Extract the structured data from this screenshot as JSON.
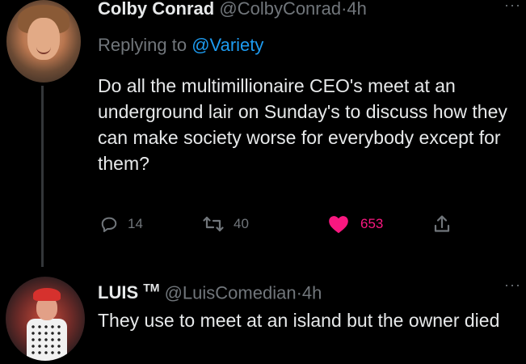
{
  "tweets": [
    {
      "display_name": "Colby Conrad",
      "handle": "@ColbyConrad",
      "separator": "·",
      "time": "4h",
      "replying_prefix": "Replying to",
      "replying_mention": "@Variety",
      "text": "Do all the multimillionaire CEO's meet at an underground lair on Sunday's to discuss how they can make society worse for everybody except for them?",
      "reply_count": "14",
      "retweet_count": "40",
      "like_count": "653",
      "avatar_icon": "profile-photo",
      "more_icon": "more-dots"
    },
    {
      "display_name": "LUIS",
      "name_suffix": "TM",
      "handle": "@LuisComedian",
      "separator": "·",
      "time": "4h",
      "text": "They use to meet at an island but the owner died",
      "avatar_icon": "profile-photo",
      "more_icon": "more-dots"
    }
  ],
  "colors": {
    "background": "#000000",
    "text": "#e7e9ea",
    "muted": "#71767b",
    "link": "#1d9bf0",
    "like": "#f91880"
  }
}
